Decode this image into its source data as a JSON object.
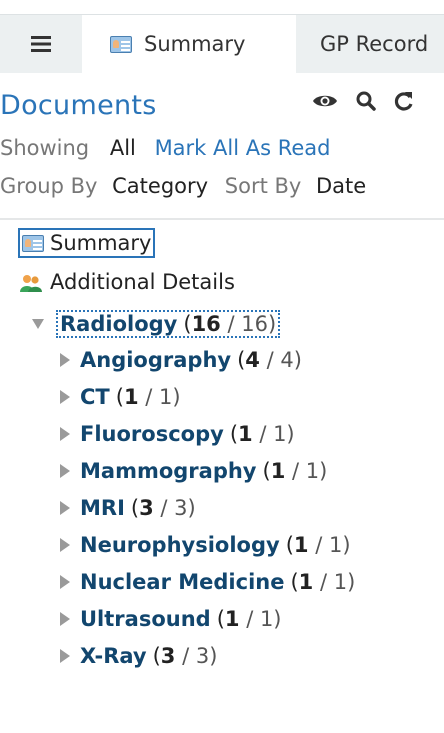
{
  "tabs": {
    "menu_icon": "hamburger-icon",
    "summary_label": "Summary",
    "gp_label": "GP Record"
  },
  "documents": {
    "title": "Documents",
    "header_icons": [
      "eye-icon",
      "search-icon",
      "refresh-icon"
    ],
    "showing_label": "Showing",
    "showing_value": "All",
    "mark_all_label": "Mark All As Read",
    "group_by_label": "Group By",
    "group_by_value": "Category",
    "sort_by_label": "Sort By",
    "sort_by_value": "Date"
  },
  "tree": {
    "summary_label": "Summary",
    "additional_label": "Additional Details",
    "root": {
      "name": "Radiology",
      "unread": "16",
      "total": "16"
    },
    "children": [
      {
        "name": "Angiography",
        "unread": "4",
        "total": "4"
      },
      {
        "name": "CT",
        "unread": "1",
        "total": "1"
      },
      {
        "name": "Fluoroscopy",
        "unread": "1",
        "total": "1"
      },
      {
        "name": "Mammography",
        "unread": "1",
        "total": "1"
      },
      {
        "name": "MRI",
        "unread": "3",
        "total": "3"
      },
      {
        "name": "Neurophysiology",
        "unread": "1",
        "total": "1"
      },
      {
        "name": "Nuclear Medicine",
        "unread": "1",
        "total": "1"
      },
      {
        "name": "Ultrasound",
        "unread": "1",
        "total": "1"
      },
      {
        "name": "X-Ray",
        "unread": "3",
        "total": "3"
      }
    ]
  },
  "colors": {
    "link_blue": "#2a74b8",
    "node_navy": "#12466e",
    "tab_bg": "#ecf0f1"
  }
}
